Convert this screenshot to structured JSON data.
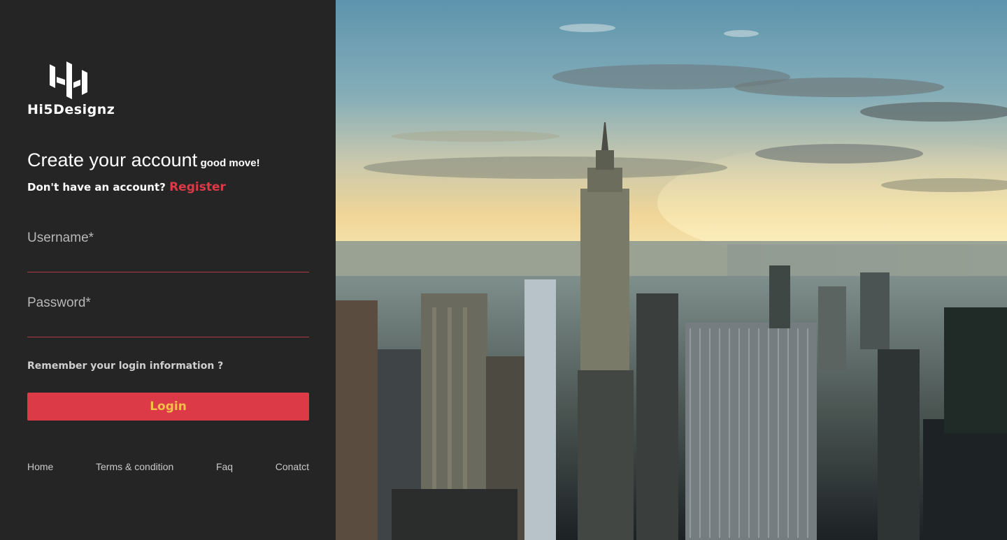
{
  "brand": {
    "logo_text": "Hi5Designz",
    "logo_icon": "hi5-logo-icon"
  },
  "form": {
    "title": "Create your account",
    "title_suffix": "good move!",
    "account_prompt": "Don't have an account?",
    "register_link": "Register",
    "username_label": "Username*",
    "username_value": "",
    "password_label": "Password*",
    "password_value": "",
    "remember_label": "Remember your login information ?",
    "login_button": "Login"
  },
  "footer": {
    "links": [
      "Home",
      "Terms & condition",
      "Faq",
      "Conatct"
    ]
  },
  "hero": {
    "image_alt": "city-skyline-photo"
  },
  "colors": {
    "panel_bg": "#252526",
    "accent_red": "#dc3a46",
    "button_text": "#f4c04a",
    "underline": "#b23a44"
  }
}
